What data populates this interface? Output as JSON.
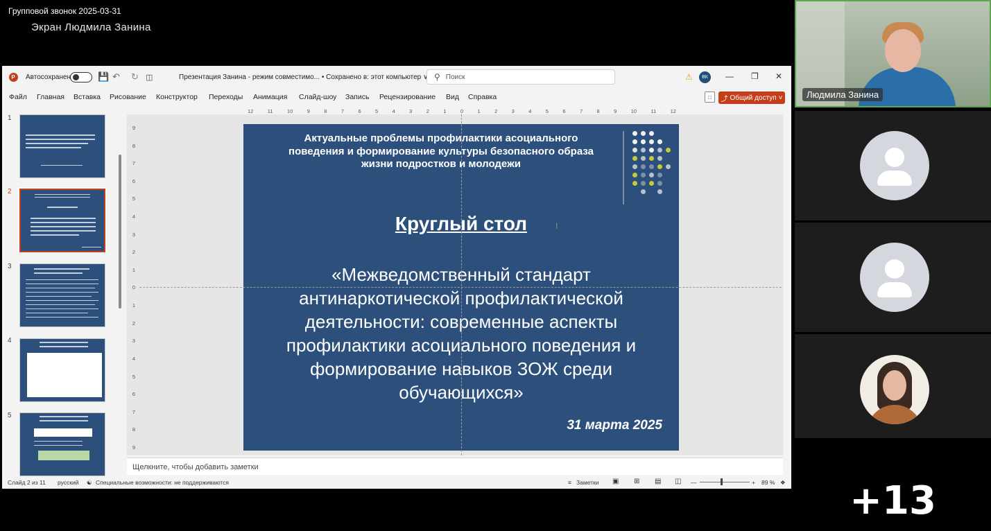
{
  "call": {
    "title": "Групповой звонок 2025-03-31",
    "screen_label": "Экран Людмила Занина",
    "extra_participants": "+13"
  },
  "ppt": {
    "autosave_label": "Автосохранение",
    "doc_title": "Презентация Занина  -  режим совместимо... • Сохранено в: этот компьютер ∨",
    "search_placeholder": "Поиск",
    "user_initials": "ВК",
    "menu": [
      "Файл",
      "Главная",
      "Вставка",
      "Рисование",
      "Конструктор",
      "Переходы",
      "Анимация",
      "Слайд-шоу",
      "Запись",
      "Рецензирование",
      "Вид",
      "Справка"
    ],
    "share_label": "Общий доступ",
    "ruler_h": [
      "12",
      "11",
      "10",
      "9",
      "8",
      "7",
      "6",
      "5",
      "4",
      "3",
      "2",
      "1",
      "0",
      "1",
      "2",
      "3",
      "4",
      "5",
      "6",
      "7",
      "8",
      "9",
      "10",
      "11",
      "12"
    ],
    "ruler_v": [
      "9",
      "8",
      "7",
      "6",
      "5",
      "4",
      "3",
      "2",
      "1",
      "0",
      "1",
      "2",
      "3",
      "4",
      "5",
      "6",
      "7",
      "8",
      "9"
    ],
    "thumbnails": [
      {
        "num": "1"
      },
      {
        "num": "2"
      },
      {
        "num": "3"
      },
      {
        "num": "4"
      },
      {
        "num": "5"
      }
    ],
    "slide": {
      "heading": "Актуальные проблемы профилактики асоциального поведения и формирование культуры безопасного образа жизни подростков и молодежи",
      "round_table": "Круглый стол",
      "main_text": "«Межведомственный стандарт антинаркотической профилактической деятельности: современные аспекты профилактики асоциального поведения и формирование навыков ЗОЖ среди обучающихся»",
      "date": "31 марта 2025"
    },
    "notes_placeholder": "Щелкните, чтобы добавить заметки",
    "status": {
      "slide_counter": "Слайд 2 из 11",
      "language": "русский",
      "accessibility": "Специальные возможности: не поддерживаются",
      "notes_label": "Заметки",
      "zoom": "89 %"
    },
    "colors": {
      "slide_bg": "#2c4f7c",
      "accent": "#c43e1c"
    }
  },
  "participants": {
    "speaker_name": "Людмила Занина"
  }
}
